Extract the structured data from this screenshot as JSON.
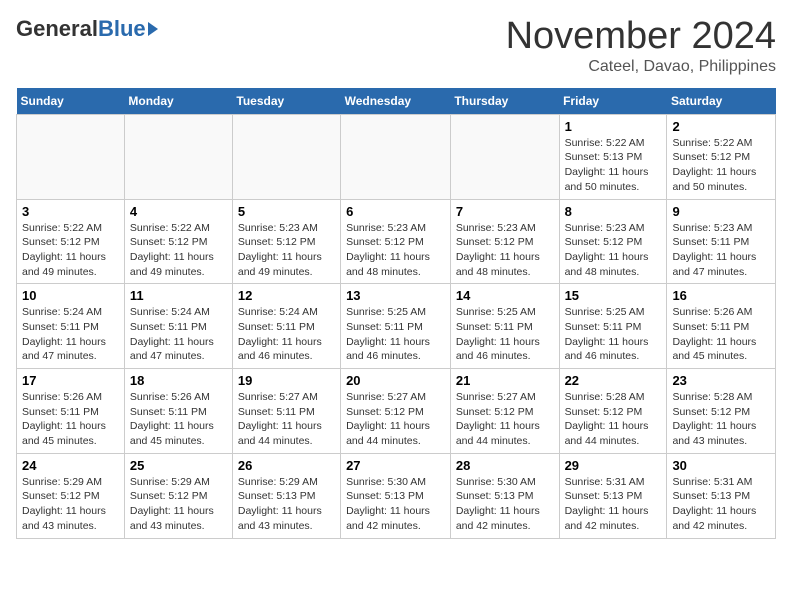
{
  "header": {
    "logo_general": "General",
    "logo_blue": "Blue",
    "month_title": "November 2024",
    "location": "Cateel, Davao, Philippines"
  },
  "calendar": {
    "days_of_week": [
      "Sunday",
      "Monday",
      "Tuesday",
      "Wednesday",
      "Thursday",
      "Friday",
      "Saturday"
    ],
    "weeks": [
      [
        {
          "day": "",
          "info": ""
        },
        {
          "day": "",
          "info": ""
        },
        {
          "day": "",
          "info": ""
        },
        {
          "day": "",
          "info": ""
        },
        {
          "day": "",
          "info": ""
        },
        {
          "day": "1",
          "info": "Sunrise: 5:22 AM\nSunset: 5:13 PM\nDaylight: 11 hours and 50 minutes."
        },
        {
          "day": "2",
          "info": "Sunrise: 5:22 AM\nSunset: 5:12 PM\nDaylight: 11 hours and 50 minutes."
        }
      ],
      [
        {
          "day": "3",
          "info": "Sunrise: 5:22 AM\nSunset: 5:12 PM\nDaylight: 11 hours and 49 minutes."
        },
        {
          "day": "4",
          "info": "Sunrise: 5:22 AM\nSunset: 5:12 PM\nDaylight: 11 hours and 49 minutes."
        },
        {
          "day": "5",
          "info": "Sunrise: 5:23 AM\nSunset: 5:12 PM\nDaylight: 11 hours and 49 minutes."
        },
        {
          "day": "6",
          "info": "Sunrise: 5:23 AM\nSunset: 5:12 PM\nDaylight: 11 hours and 48 minutes."
        },
        {
          "day": "7",
          "info": "Sunrise: 5:23 AM\nSunset: 5:12 PM\nDaylight: 11 hours and 48 minutes."
        },
        {
          "day": "8",
          "info": "Sunrise: 5:23 AM\nSunset: 5:12 PM\nDaylight: 11 hours and 48 minutes."
        },
        {
          "day": "9",
          "info": "Sunrise: 5:23 AM\nSunset: 5:11 PM\nDaylight: 11 hours and 47 minutes."
        }
      ],
      [
        {
          "day": "10",
          "info": "Sunrise: 5:24 AM\nSunset: 5:11 PM\nDaylight: 11 hours and 47 minutes."
        },
        {
          "day": "11",
          "info": "Sunrise: 5:24 AM\nSunset: 5:11 PM\nDaylight: 11 hours and 47 minutes."
        },
        {
          "day": "12",
          "info": "Sunrise: 5:24 AM\nSunset: 5:11 PM\nDaylight: 11 hours and 46 minutes."
        },
        {
          "day": "13",
          "info": "Sunrise: 5:25 AM\nSunset: 5:11 PM\nDaylight: 11 hours and 46 minutes."
        },
        {
          "day": "14",
          "info": "Sunrise: 5:25 AM\nSunset: 5:11 PM\nDaylight: 11 hours and 46 minutes."
        },
        {
          "day": "15",
          "info": "Sunrise: 5:25 AM\nSunset: 5:11 PM\nDaylight: 11 hours and 46 minutes."
        },
        {
          "day": "16",
          "info": "Sunrise: 5:26 AM\nSunset: 5:11 PM\nDaylight: 11 hours and 45 minutes."
        }
      ],
      [
        {
          "day": "17",
          "info": "Sunrise: 5:26 AM\nSunset: 5:11 PM\nDaylight: 11 hours and 45 minutes."
        },
        {
          "day": "18",
          "info": "Sunrise: 5:26 AM\nSunset: 5:11 PM\nDaylight: 11 hours and 45 minutes."
        },
        {
          "day": "19",
          "info": "Sunrise: 5:27 AM\nSunset: 5:11 PM\nDaylight: 11 hours and 44 minutes."
        },
        {
          "day": "20",
          "info": "Sunrise: 5:27 AM\nSunset: 5:12 PM\nDaylight: 11 hours and 44 minutes."
        },
        {
          "day": "21",
          "info": "Sunrise: 5:27 AM\nSunset: 5:12 PM\nDaylight: 11 hours and 44 minutes."
        },
        {
          "day": "22",
          "info": "Sunrise: 5:28 AM\nSunset: 5:12 PM\nDaylight: 11 hours and 44 minutes."
        },
        {
          "day": "23",
          "info": "Sunrise: 5:28 AM\nSunset: 5:12 PM\nDaylight: 11 hours and 43 minutes."
        }
      ],
      [
        {
          "day": "24",
          "info": "Sunrise: 5:29 AM\nSunset: 5:12 PM\nDaylight: 11 hours and 43 minutes."
        },
        {
          "day": "25",
          "info": "Sunrise: 5:29 AM\nSunset: 5:12 PM\nDaylight: 11 hours and 43 minutes."
        },
        {
          "day": "26",
          "info": "Sunrise: 5:29 AM\nSunset: 5:13 PM\nDaylight: 11 hours and 43 minutes."
        },
        {
          "day": "27",
          "info": "Sunrise: 5:30 AM\nSunset: 5:13 PM\nDaylight: 11 hours and 42 minutes."
        },
        {
          "day": "28",
          "info": "Sunrise: 5:30 AM\nSunset: 5:13 PM\nDaylight: 11 hours and 42 minutes."
        },
        {
          "day": "29",
          "info": "Sunrise: 5:31 AM\nSunset: 5:13 PM\nDaylight: 11 hours and 42 minutes."
        },
        {
          "day": "30",
          "info": "Sunrise: 5:31 AM\nSunset: 5:13 PM\nDaylight: 11 hours and 42 minutes."
        }
      ]
    ]
  }
}
